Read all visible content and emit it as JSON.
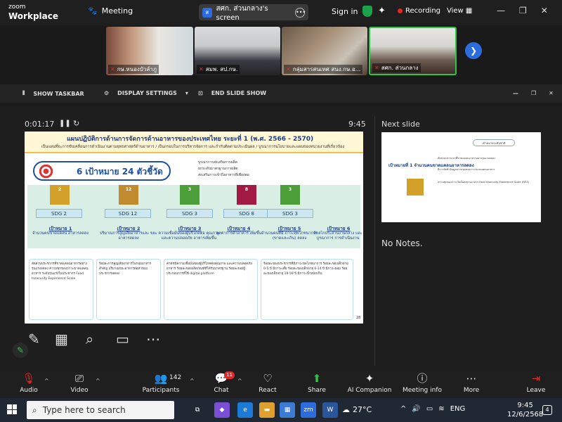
{
  "app": {
    "logo_line1": "zoom",
    "logo_line2": "Workplace",
    "meeting_label": "Meeting",
    "screen_title": "สศก. ส่วนกลาง's screen",
    "sign_in": "Sign in",
    "recording": "Recording",
    "view": "View"
  },
  "videos": [
    {
      "name": "กษ.หนองบัวลำภู"
    },
    {
      "name": "สมพ. สป.กษ."
    },
    {
      "name": "กลุ่มสารสนเทศ สนง.กษ.อ..."
    },
    {
      "name": "สศก. ส่วนกลาง"
    }
  ],
  "share_toolbar": {
    "show_taskbar": "SHOW TASKBAR",
    "display_settings": "DISPLAY SETTINGS",
    "end_slide_show": "END SLIDE SHOW"
  },
  "presenter": {
    "timer": "0:01:17",
    "clock": "9:45",
    "next_slide": "Next slide",
    "notes": "No Notes."
  },
  "slide": {
    "title": "แผนปฏิบัติการด้านการจัดการด้านอาหารของประเทศไทย ระยะที่ 1 (พ.ศ. 2566 - 2570)",
    "subtitle": "เป็นแผนที่จะการขับเคลื่อนการดำเนินงานตามยุทธศาสตร์ด้านอาหาร / เป็นกรอบในการบริหารจัดการ และกำกับติดตามประเมินผล / บูรณาการนโยบายและแผนของหน่วยงานที่เกี่ยวข้อง",
    "goal_pill": "6 เป้าหมาย  24 ตัวชี้วัด",
    "bullets": [
      "บูรณาการส่งเสริมการผลิต",
      "ยกระดับมาตรฐานการผลิต",
      "ส่งเสริมการเข้าถึงอาหารที่เพียงพอ"
    ],
    "sdgs": [
      "SDG 2",
      "SDG 12",
      "SDG 3",
      "SDG 8",
      "SDG 3"
    ],
    "goals": [
      {
        "title": "เป้าหมาย 1",
        "sub": "จำนวนคนขาดแคลน อาหารลดลง"
      },
      {
        "title": "เป้าหมาย 2",
        "sub": "ปริมาณการสูญเสียอาหารและ ขยะอาหารลดลง"
      },
      {
        "title": "เป้าหมาย 3",
        "sub": "ความเชื่อมั่นของผู้บริโภคต่อ คุณภาพและความปลอดภัย อาหารเพิ่มขึ้น"
      },
      {
        "title": "เป้าหมาย 4",
        "sub": "มูลค่าการค้าอาหาร เพิ่มขึ้น"
      },
      {
        "title": "เป้าหมาย 5",
        "sub": "จำนวนคนที่มี ภาวะทุพโภชนาการ (ขาดและเกิน) ลดลง"
      },
      {
        "title": "เป้าหมาย 6",
        "sub": "มีกลไกประสานงานกลาง และบูรณาการ การดำเนินงาน"
      }
    ],
    "indicators": [
      "สัดส่วนประชากรที่ขาดแคลนอาหารอย่างรุนแรงลดลง ความชุกของภาวะขาดแคลนอาหาร ระดับรุนแรงในประชากร Food Insecurity Experience Scale",
      "ร้อยละการสูญเสียอาหารในกลุ่มอาหารสำคัญ ปริมาณขยะอาหารต่อหัวของประชากรลดลง",
      "ค่าดัชนีความเชื่อมั่นของผู้บริโภคต่อคุณภาพ และความปลอดภัยอาหาร ร้อยละของผลิตภัณฑ์ที่ได้รับมาตรฐาน ร้อยละของผู้ประกอบการที่ใช้ digital platform",
      "ร้อยละของประชากรที่มีภาวะทุพโภชนาการ ร้อยละของเด็กอายุ 0-5 ปี มีภาวะเตี้ย ร้อยละของเด็กอายุ 6-14 ปี มีภาวะผอม ร้อยละของเด็กอายุ 19-59 ปี มีภาวะน้ำหนักเกิน"
    ],
    "page_no": "28"
  },
  "next_slide": {
    "pill": "เป้าหมายระดับชาติ",
    "goal": "เป้าหมายที่ 1 จำนวนคนขาดแคลนอาหารลดลง",
    "rows": [
      "สัดส่วนประชากรที่ขาดแคลนอาหารอย่างรุนแรงลดลง",
      "มีการจัดทำข้อมูลความชุกของภาวะขาดแคลนอาหาร",
      "ความชุกของภาวะไม่มั่นคงทางอาหาร Food Insecurity Experience Scale (FIES)"
    ]
  },
  "controls": {
    "audio": "Audio",
    "video": "Video",
    "participants": "Participants",
    "participants_count": "142",
    "chat": "Chat",
    "chat_badge": "11",
    "react": "React",
    "share": "Share",
    "ai": "AI Companion",
    "info": "Meeting info",
    "more": "More",
    "leave": "Leave"
  },
  "taskbar": {
    "search": "Type here to search",
    "temp": "27°C",
    "lang": "ENG",
    "time": "9:45",
    "date": "12/6/2568",
    "notif": "4"
  }
}
